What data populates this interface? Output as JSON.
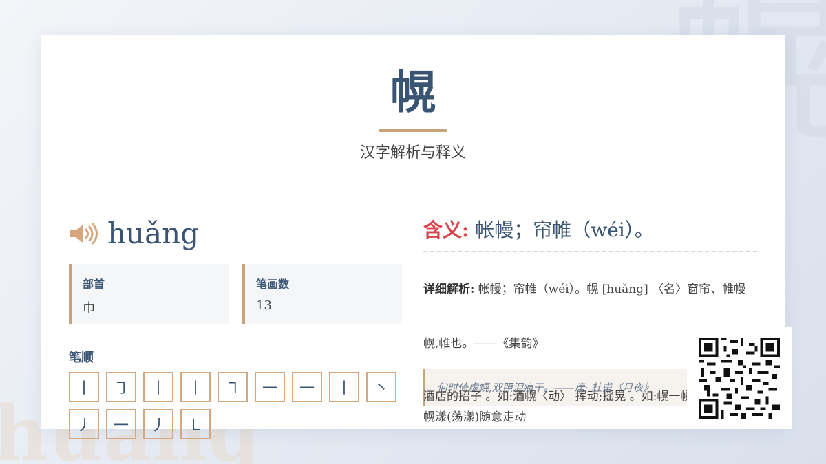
{
  "background": {
    "char": "幌",
    "pinyin": "huang"
  },
  "header": {
    "character": "幌",
    "subtitle": "汉字解析与释义"
  },
  "pronunciation": {
    "pinyin": "huǎng",
    "icon": "speaker-icon"
  },
  "info": {
    "radical_label": "部首",
    "radical_value": "巾",
    "strokes_label": "笔画数",
    "strokes_value": "13"
  },
  "stroke_order": {
    "label": "笔顺",
    "strokes": [
      "丨",
      "㇆",
      "丨",
      "丨",
      "㇕",
      "一",
      "一",
      "丨",
      "丶",
      "丿",
      "一",
      "丿",
      "㇄"
    ]
  },
  "meaning": {
    "label": "含义:",
    "text": "帐幔；帘帷（wéi）。"
  },
  "detail": {
    "label": "详细解析:",
    "text": "帐幔；帘帷（wéi）。幌 [huǎng] 〈名〉窗帘、帷幔"
  },
  "source": "幌,帷也。——《集韵》",
  "quote": "何时倚虚幌,双照泪痕干。——唐· 杜甫《月夜》",
  "extra": "酒店的招子 。如:酒幌〈动〉 挥动;摇晃 。如:幌一幌;身子乱幌;幌漾(荡漾)随意走动",
  "qr": {
    "icon": "qr-code-icon"
  },
  "colors": {
    "accent": "#c9a37a",
    "primary": "#3a5474",
    "highlight": "#d9434a"
  }
}
